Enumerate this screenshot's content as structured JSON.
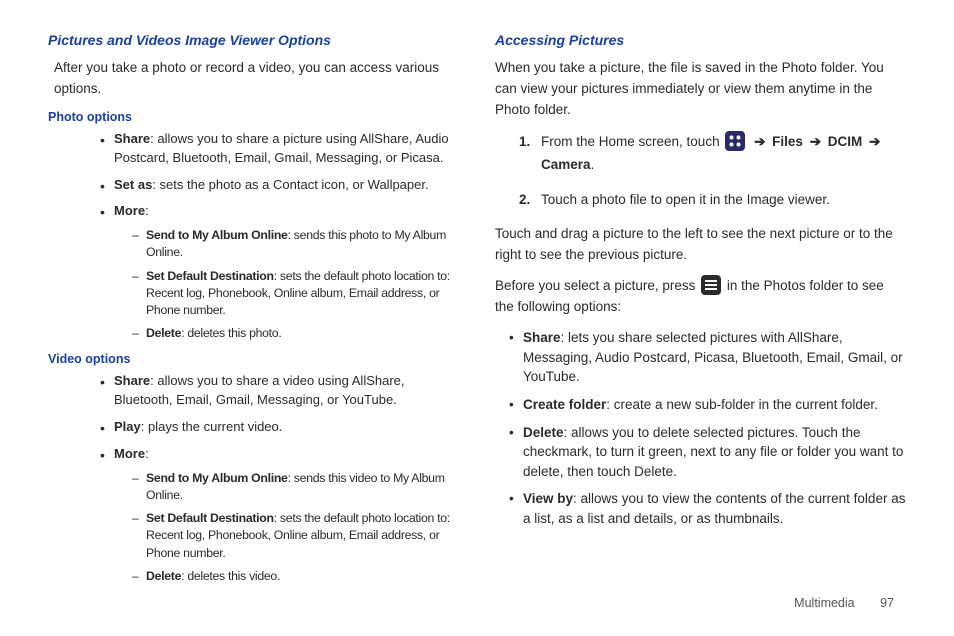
{
  "left": {
    "h1": "Pictures and Videos Image Viewer Options",
    "intro": "After you take a photo or record a video, you can access various options.",
    "photo_h": "Photo options",
    "photo": {
      "share_b": "Share",
      "share_t": ": allows you to share a picture using AllShare, Audio Postcard, Bluetooth, Email, Gmail, Messaging, or Picasa.",
      "setas_b": "Set as",
      "setas_t": ": sets the photo as a Contact icon, or Wallpaper.",
      "more_b": "More",
      "more_t": ":",
      "d1_b": "Send to My Album Online",
      "d1_t": ": sends this photo to My Album Online.",
      "d2_b": "Set Default Destination",
      "d2_t": ": sets the default photo location to: Recent log, Phonebook, Online album, Email address, or Phone number.",
      "d3_b": "Delete",
      "d3_t": ": deletes this photo."
    },
    "video_h": "Video options",
    "video": {
      "share_b": "Share",
      "share_t": ": allows you to share a video using AllShare, Bluetooth, Email, Gmail, Messaging, or YouTube.",
      "play_b": "Play",
      "play_t": ": plays the current video.",
      "more_b": "More",
      "more_t": ":",
      "d1_b": "Send to My Album Online",
      "d1_t": ": sends this video to My Album Online.",
      "d2_b": "Set Default Destination",
      "d2_t": ": sets the default photo location to: Recent log, Phonebook, Online album, Email address, or Phone number.",
      "d3_b": "Delete",
      "d3_t": ": deletes this video."
    }
  },
  "right": {
    "h1": "Accessing Pictures",
    "intro": "When you take a picture, the file is saved in the Photo folder. You can view your pictures immediately or view them anytime in the Photo folder.",
    "step1_pre": "From the Home screen, touch ",
    "step1_files": "Files",
    "step1_dcim": "DCIM",
    "step1_camera": "Camera",
    "step1_period": ".",
    "step2": "Touch a photo file to open it in the Image viewer.",
    "para2": "Touch and drag a picture to the left to see the next picture or to the right to see the previous picture.",
    "para3_pre": "Before you select a picture, press ",
    "para3_post": " in the Photos folder to see the following options:",
    "opts": {
      "share_b": "Share",
      "share_t": ": lets you share selected pictures with AllShare, Messaging, Audio Postcard, Picasa, Bluetooth, Email, Gmail, or YouTube.",
      "cf_b": "Create folder",
      "cf_t": ": create a new sub-folder in the current folder.",
      "del_b": "Delete",
      "del_t": ": allows you to delete selected pictures. Touch the checkmark, to turn it green, next to any file or folder you want to delete, then touch Delete.",
      "vb_b": "View by",
      "vb_t": ": allows you to view the contents of the current folder as a list, as a list and details, or as thumbnails."
    }
  },
  "footer": {
    "section": "Multimedia",
    "page": "97"
  },
  "arrow": "➔",
  "num1": "1.",
  "num2": "2."
}
